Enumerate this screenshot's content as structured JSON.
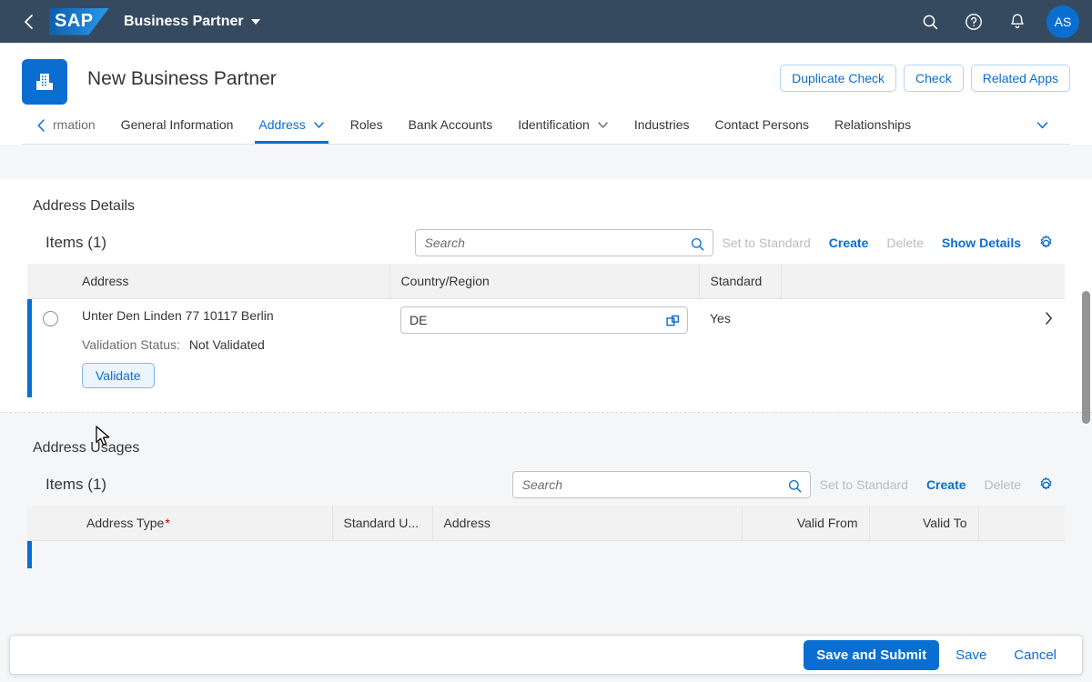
{
  "shell": {
    "back_icon": "chevron-left-icon",
    "logo_text": "SAP",
    "app_title": "Business Partner",
    "search_icon": "search-icon",
    "help_icon": "question-mark-circle-icon",
    "notifications_icon": "bell-icon",
    "avatar_initials": "AS"
  },
  "object_header": {
    "icon": "company-building-icon",
    "title": "New Business Partner",
    "actions": [
      {
        "label": "Duplicate Check"
      },
      {
        "label": "Check"
      },
      {
        "label": "Related Apps"
      }
    ]
  },
  "tabs": {
    "scroll_left_icon": "chevron-left-icon",
    "overflow_icon": "chevron-down-icon",
    "items": [
      {
        "label": "rmation",
        "active": false,
        "truncated": true,
        "has_menu": false
      },
      {
        "label": "General Information",
        "active": false,
        "has_menu": false
      },
      {
        "label": "Address",
        "active": true,
        "has_menu": true
      },
      {
        "label": "Roles",
        "active": false,
        "has_menu": false
      },
      {
        "label": "Bank Accounts",
        "active": false,
        "has_menu": false
      },
      {
        "label": "Identification",
        "active": false,
        "has_menu": true
      },
      {
        "label": "Industries",
        "active": false,
        "has_menu": false
      },
      {
        "label": "Contact Persons",
        "active": false,
        "has_menu": false
      },
      {
        "label": "Relationships",
        "active": false,
        "has_menu": false
      }
    ]
  },
  "address_details": {
    "section_title": "Address Details",
    "items_count_label": "Items (1)",
    "search_placeholder": "Search",
    "search_value": "",
    "search_icon": "search-icon",
    "settings_icon": "gear-icon",
    "toolbar": [
      {
        "label": "Set to Standard",
        "disabled": true
      },
      {
        "label": "Create",
        "disabled": false
      },
      {
        "label": "Delete",
        "disabled": true
      },
      {
        "label": "Show Details",
        "disabled": false
      }
    ],
    "columns": [
      "Address",
      "Country/Region",
      "Standard"
    ],
    "row": {
      "address": "Unter Den Linden 77 10117 Berlin",
      "validation_status_label": "Validation Status:",
      "validation_status_value": "Not Validated",
      "validate_button": "Validate",
      "country_value": "DE",
      "country_value_help_icon": "value-help-icon",
      "standard": "Yes",
      "nav_icon": "chevron-right-icon",
      "radio_icon": "radio-button-icon"
    }
  },
  "address_usages": {
    "section_title": "Address Usages",
    "items_count_label": "Items (1)",
    "search_placeholder": "Search",
    "search_value": "",
    "search_icon": "search-icon",
    "settings_icon": "gear-icon",
    "toolbar": [
      {
        "label": "Set to Standard",
        "disabled": true
      },
      {
        "label": "Create",
        "disabled": false
      },
      {
        "label": "Delete",
        "disabled": true
      }
    ],
    "columns": [
      {
        "label": "Address Type",
        "required": true,
        "align": "left"
      },
      {
        "label": "Standard U...",
        "required": false,
        "align": "left"
      },
      {
        "label": "Address",
        "required": false,
        "align": "left"
      },
      {
        "label": "Valid From",
        "required": false,
        "align": "right"
      },
      {
        "label": "Valid To",
        "required": false,
        "align": "right"
      }
    ]
  },
  "footer": {
    "primary_label": "Save and Submit",
    "save_label": "Save",
    "cancel_label": "Cancel"
  },
  "colors": {
    "shell_bg": "#354a5f",
    "accent": "#0a6ed1",
    "required": "#bb0000",
    "disabled_text": "#b9bcbf"
  }
}
